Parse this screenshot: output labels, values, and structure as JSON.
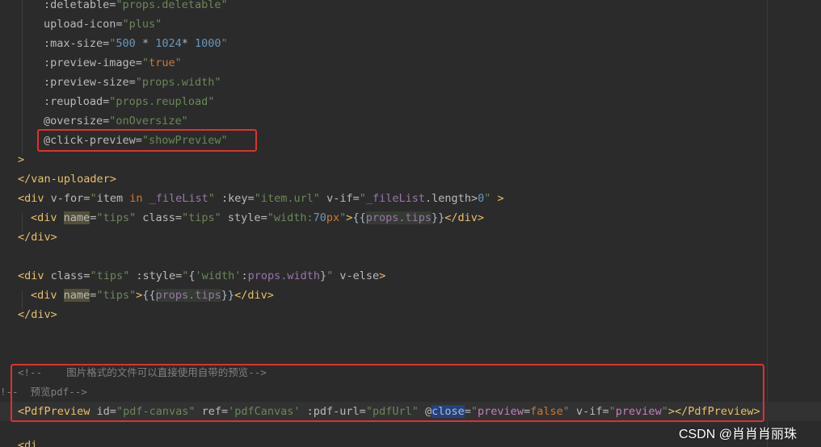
{
  "code": {
    "l1_attr": ":deletable=",
    "l1_val": "\"props.deletable\"",
    "l2_attr": "upload-icon=",
    "l2_val": "\"plus\"",
    "l3_attr": ":max-size=",
    "l3_q1": "\"",
    "l3_n1": "500",
    "l3_op1": " * ",
    "l3_n2": "1024",
    "l3_op2": "* ",
    "l3_n3": "1000",
    "l3_q2": "\"",
    "l4_attr": ":preview-image=",
    "l4_q1": "\"",
    "l4_val": "true",
    "l4_q2": "\"",
    "l5_attr": ":preview-size=",
    "l5_val": "\"props.width\"",
    "l6_attr": ":reupload=",
    "l6_val": "\"props.reupload\"",
    "l7_attr": "@oversize=",
    "l7_val": "\"onOversize\"",
    "l8_attr": "@click-preview=",
    "l8_val": "\"showPreview\"",
    "l9": ">",
    "l10_open": "</",
    "l10_tag": "van-uploader",
    "l10_close": ">",
    "l11_lt": "<",
    "l11_tag": "div",
    "l11_vfor": " v-for=",
    "l11_q1": "\"",
    "l11_item": "item",
    "l11_in": " in ",
    "l11_list": "_fileList",
    "l11_q2": "\"",
    "l11_key": " :key=",
    "l11_keyval": "\"item.url\"",
    "l11_vif": " v-if=",
    "l11_q3": "\"",
    "l11_list2": "_fileList",
    "l11_len": ".length>",
    "l11_zero": "0",
    "l11_q4": "\"",
    "l11_gt": " >",
    "l12_lt": "<",
    "l12_tag": "div",
    "l12_name": "name",
    "l12_eq": "=",
    "l12_nameval": "\"tips\"",
    "l12_class": " class=",
    "l12_classval": "\"tips\"",
    "l12_style": " style=",
    "l12_style_q1": "\"",
    "l12_style_prop": "width:",
    "l12_style_num": "70",
    "l12_style_unit": "px",
    "l12_style_q2": "\"",
    "l12_gt": ">",
    "l12_ob": "{{",
    "l12_interp": "props.tips",
    "l12_cb": "}}",
    "l12_end_lt": "</",
    "l12_end_tag": "div",
    "l12_end_gt": ">",
    "l13_open": "</",
    "l13_tag": "div",
    "l13_close": ">",
    "l15_lt": "<",
    "l15_tag": "div",
    "l15_class": " class=",
    "l15_classval": "\"tips\"",
    "l15_style": " :style=",
    "l15_q1": "\"",
    "l15_ob": "{",
    "l15_key": "'width'",
    "l15_colon": ":",
    "l15_val": "props.width",
    "l15_cb": "}",
    "l15_q2": "\"",
    "l15_velse": " v-else",
    "l15_gt": ">",
    "l16_lt": "<",
    "l16_tag": "div",
    "l16_name": "name",
    "l16_eq": "=",
    "l16_nameval": "\"tips\"",
    "l16_gt": ">",
    "l16_ob": "{{",
    "l16_interp": "props.tips",
    "l16_cb": "}}",
    "l16_end_lt": "</",
    "l16_end_tag": "div",
    "l16_end_gt": ">",
    "l17_open": "</",
    "l17_tag": "div",
    "l17_close": ">",
    "l19_comment": "<!--    图片格式的文件可以直接使用自带的预览-->",
    "l20_comment": "!--  预览pdf-->",
    "l21_lt": "<",
    "l21_tag": "PdfPreview",
    "l21_id": " id=",
    "l21_idval": "\"pdf-canvas\"",
    "l21_ref": " ref=",
    "l21_refval": "'pdfCanvas'",
    "l21_pdfurl": " :pdf-url=",
    "l21_pdfurlval": "\"pdfUrl\"",
    "l21_space": " ",
    "l21_at": "@",
    "l21_close": "close",
    "l21_eq": "=",
    "l21_q1": "\"",
    "l21_preview": "preview",
    "l21_eq2": "=",
    "l21_false": "false",
    "l21_q2": "\"",
    "l21_vif": " v-if=",
    "l21_q3": "\"",
    "l21_preview2": "preview",
    "l21_q4": "\"",
    "l21_gt": ">",
    "l21_end_lt": "</",
    "l21_end_tag": "PdfPreview",
    "l21_end_gt": ">",
    "l23": "<di"
  },
  "watermark": "CSDN @肖肖肖丽珠",
  "colors": {
    "background": "#2b2b2b",
    "tag": "#e8bf6a",
    "attribute": "#bababa",
    "string": "#6a8759",
    "number": "#6897bb",
    "keyword": "#cc7832",
    "variable": "#9876aa",
    "comment": "#808080",
    "annotation_box": "#e0312d"
  }
}
